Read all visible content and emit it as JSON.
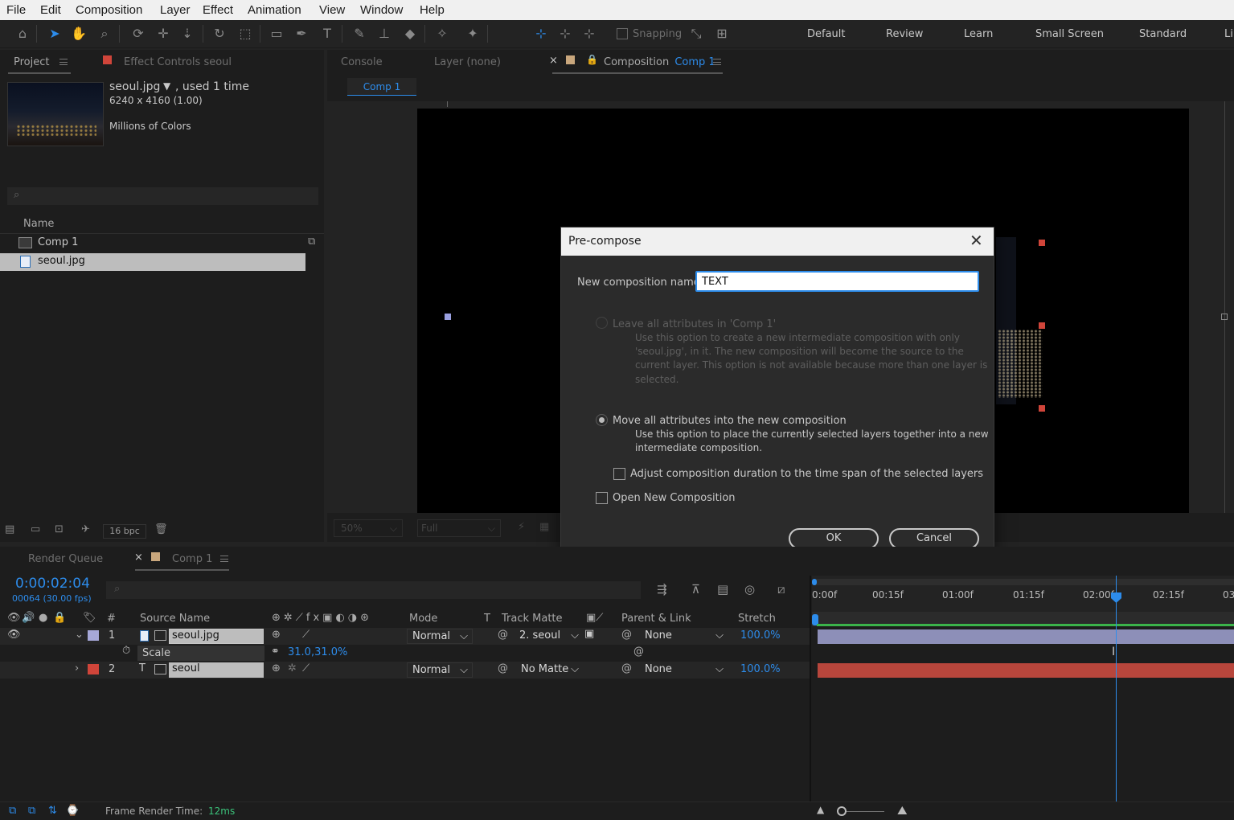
{
  "menu": {
    "file": "File",
    "edit": "Edit",
    "composition": "Composition",
    "layer": "Layer",
    "effect": "Effect",
    "animation": "Animation",
    "view": "View",
    "window": "Window",
    "help": "Help"
  },
  "toolbar": {
    "snapping": "Snapping",
    "workspaces": [
      "Default",
      "Review",
      "Learn",
      "Small Screen",
      "Standard",
      "Li"
    ]
  },
  "project": {
    "tab": "Project",
    "effect_controls_tab": "Effect Controls seoul",
    "item_name": "seoul.jpg",
    "used": ", used 1 time",
    "dimensions": "6240 x 4160 (1.00)",
    "colors": "Millions of Colors",
    "col_name": "Name",
    "items": [
      {
        "name": "Comp 1"
      },
      {
        "name": "seoul.jpg"
      }
    ],
    "bpc": "16 bpc"
  },
  "viewer": {
    "console_tab": "Console",
    "layer_tab": "Layer (none)",
    "comp_tab_prefix": "Composition",
    "comp_tab_name": "Comp 1",
    "comp_chip": "Comp 1",
    "zoom": "50%",
    "resolution": "Full"
  },
  "dialog": {
    "title": "Pre-compose",
    "name_label": "New composition name:",
    "name_value": "TEXT",
    "opt1_label": "Leave all attributes in 'Comp 1'",
    "opt1_desc1": "Use this option to create a new intermediate composition with only",
    "opt1_desc2": "'seoul.jpg', in it. The new composition will become the source to the",
    "opt1_desc3": "current layer. This option is not available because more than one layer is",
    "opt1_desc4": "selected.",
    "opt2_label": "Move all attributes into the new composition",
    "opt2_desc1": "Use this option to place the currently selected layers together into a new",
    "opt2_desc2": "intermediate composition.",
    "adjust_label": "Adjust composition duration to the time span of the selected layers",
    "open_label": "Open New Composition",
    "ok": "OK",
    "cancel": "Cancel",
    "selected_option": "move_all",
    "adjust_checked": false,
    "open_checked": false
  },
  "timeline": {
    "render_queue_tab": "Render Queue",
    "comp_tab": "Comp 1",
    "timecode": "0:00:02:04",
    "frames": "00064 (30.00 fps)",
    "headers": {
      "num": "#",
      "source": "Source Name",
      "mode": "Mode",
      "t": "T",
      "track_matte": "Track Matte",
      "parent": "Parent & Link",
      "stretch": "Stretch"
    },
    "ruler": [
      "0:00f",
      "00:15f",
      "01:00f",
      "01:15f",
      "02:00f",
      "02:15f",
      "03"
    ],
    "layers": [
      {
        "num": "1",
        "name": "seoul.jpg",
        "mode": "Normal",
        "matte": "2. seoul",
        "parent": "None",
        "stretch": "100.0%",
        "color": "#a6a8d8"
      },
      {
        "num": "2",
        "name": "seoul",
        "mode": "Normal",
        "matte": "No Matte",
        "parent": "None",
        "stretch": "100.0%",
        "color": "#d0453a"
      }
    ],
    "scale_label": "Scale",
    "scale_value": "31.0,31.0%"
  },
  "status": {
    "render_label": "Frame Render Time:",
    "render_value": "12ms"
  }
}
